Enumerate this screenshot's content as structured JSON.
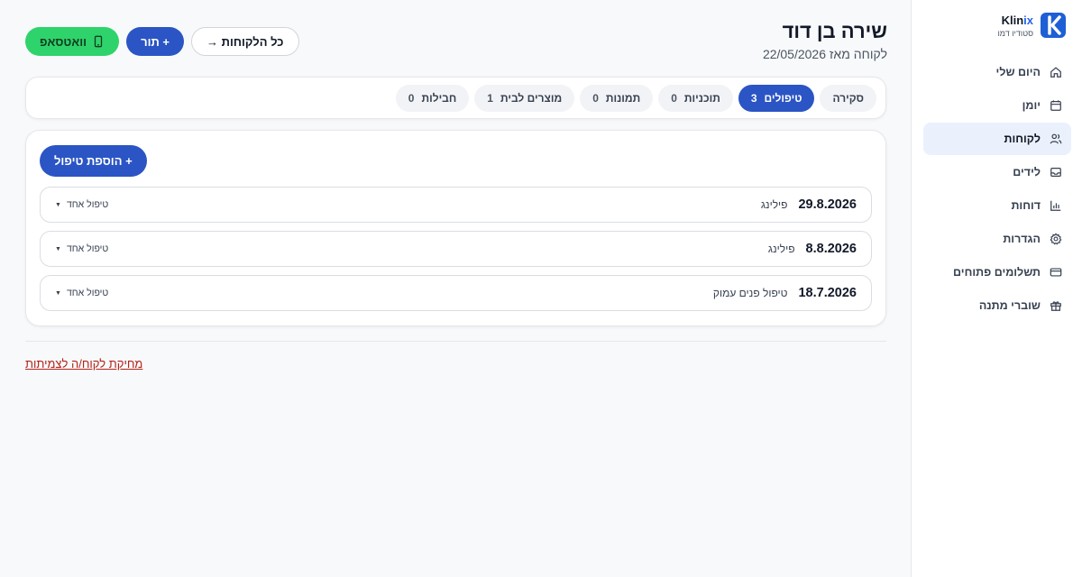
{
  "brand": {
    "name_main": "Klin",
    "name_accent": "ix",
    "subtitle": "סטודיו דמו"
  },
  "sidebar": {
    "items": [
      {
        "label": "היום שלי",
        "icon": "home-icon"
      },
      {
        "label": "יומן",
        "icon": "calendar-icon"
      },
      {
        "label": "לקוחות",
        "icon": "users-icon",
        "active": true
      },
      {
        "label": "לידים",
        "icon": "inbox-icon"
      },
      {
        "label": "דוחות",
        "icon": "bar-chart-icon"
      },
      {
        "label": "הגדרות",
        "icon": "gear-icon"
      },
      {
        "label": "תשלומים פתוחים",
        "icon": "credit-card-icon"
      },
      {
        "label": "שוברי מתנה",
        "icon": "gift-icon"
      }
    ]
  },
  "header": {
    "client_name": "שירה בן דוד",
    "client_since": "לקוחה מאז 22/05/2026"
  },
  "actions": {
    "whatsapp_label": "וואטסאפ",
    "appointment_label": "+ תור",
    "all_clients_label": "כל הלקוחות →"
  },
  "tabs": [
    {
      "label": "סקירה",
      "count": ""
    },
    {
      "label": "טיפולים",
      "count": "3",
      "active": true
    },
    {
      "label": "תוכניות",
      "count": "0"
    },
    {
      "label": "תמונות",
      "count": "0"
    },
    {
      "label": "מוצרים לבית",
      "count": "1"
    },
    {
      "label": "חבילות",
      "count": "0"
    }
  ],
  "treatments": {
    "add_label": "+ הוספת טיפול",
    "rows": [
      {
        "date": "29.8.2026",
        "name": "פילינג",
        "type": "טיפול אחד"
      },
      {
        "date": "8.8.2026",
        "name": "פילינג",
        "type": "טיפול אחד"
      },
      {
        "date": "18.7.2026",
        "name": "טיפול פנים עמוק",
        "type": "טיפול אחד"
      }
    ]
  },
  "footer": {
    "delete_label": "מחיקת לקוח/ה לצמיתות"
  },
  "colors": {
    "primary": "#2b55c4",
    "whatsapp": "#2fd36b",
    "danger": "#b42318",
    "active_nav_bg": "#eaf1fd"
  }
}
